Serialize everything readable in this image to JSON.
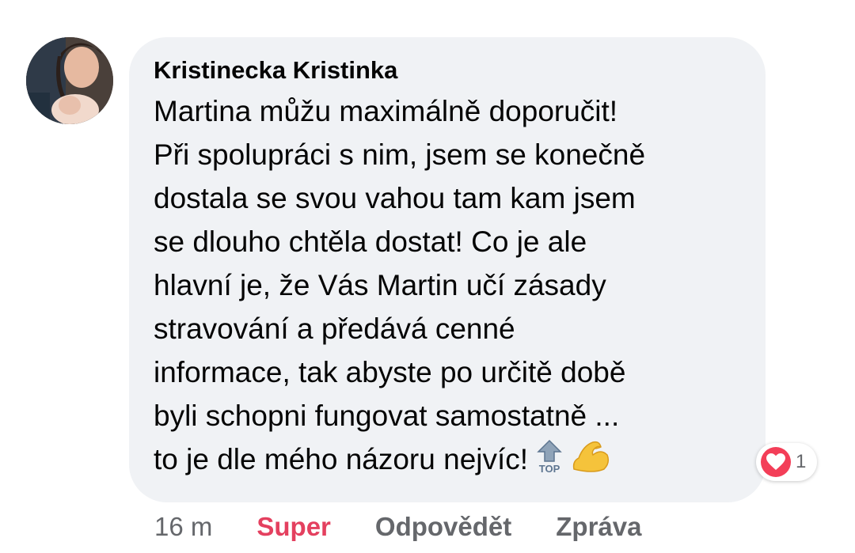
{
  "comment": {
    "author": "Kristinecka Kristinka",
    "lines": [
      "Martina můžu maximálně doporučit!",
      "Při spolupráci s nim, jsem se konečně",
      "dostala se svou vahou tam kam jsem",
      "se dlouho chtěla dostat! Co je ale",
      "hlavní je, že Vás Martin učí zásady",
      "stravování a předává cenné",
      "informace, tak abyste po určitě době",
      "byli schopni fungovat samostatně ...",
      "to je dle mého názoru nejvíc!"
    ],
    "emojis": [
      "top-arrow-icon",
      "flexed-biceps-icon"
    ]
  },
  "reaction": {
    "type": "heart-icon",
    "count": "1",
    "color": "#f33e58"
  },
  "actions": {
    "time": "16 m",
    "like_label": "Super",
    "reply_label": "Odpovědět",
    "message_label": "Zpráva"
  },
  "colors": {
    "bubble": "#f0f2f5",
    "text": "#050505",
    "secondary": "#65676b",
    "like_active": "#e4405f"
  }
}
